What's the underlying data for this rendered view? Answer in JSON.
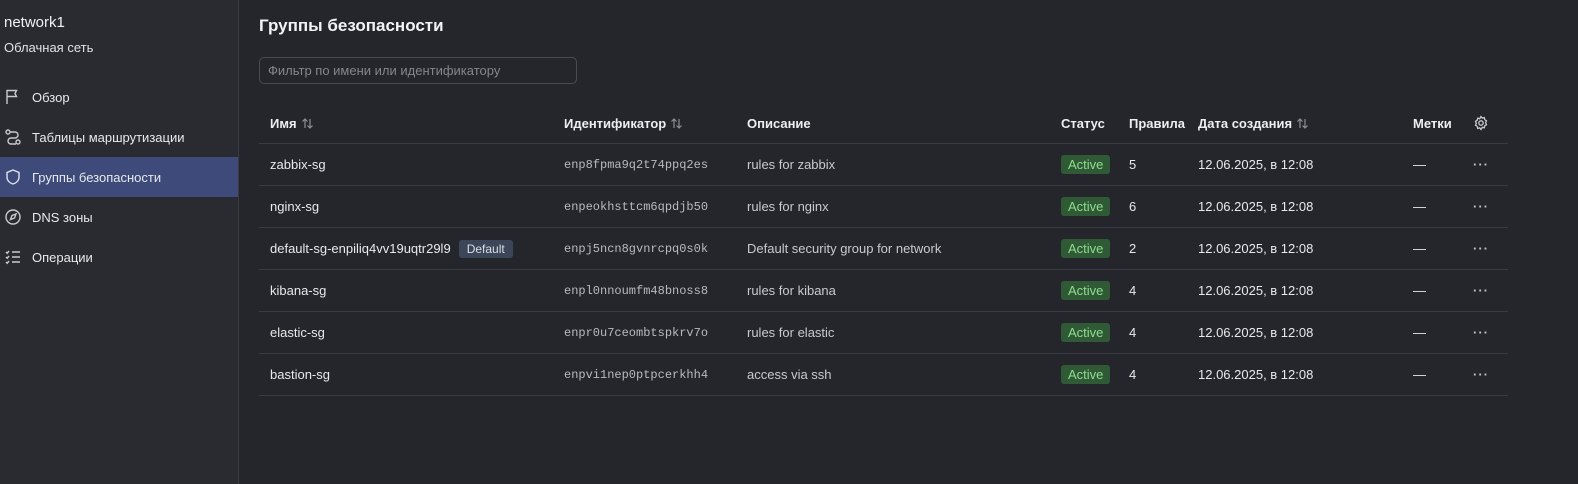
{
  "sidebar": {
    "title": "network1",
    "subtitle": "Облачная сеть",
    "items": [
      {
        "label": "Обзор",
        "icon": "flag-icon"
      },
      {
        "label": "Таблицы маршрутизации",
        "icon": "route-icon"
      },
      {
        "label": "Группы безопасности",
        "icon": "shield-icon",
        "active": true
      },
      {
        "label": "DNS зоны",
        "icon": "dns-icon"
      },
      {
        "label": "Операции",
        "icon": "list-icon"
      }
    ]
  },
  "main": {
    "title": "Группы безопасности",
    "filter_placeholder": "Фильтр по имени или идентификатору"
  },
  "table": {
    "columns": {
      "name": "Имя",
      "id": "Идентификатор",
      "description": "Описание",
      "status": "Статус",
      "rules": "Правила",
      "created": "Дата создания",
      "labels": "Метки"
    },
    "rows": [
      {
        "name": "zabbix-sg",
        "badge": "",
        "id": "enp8fpma9q2t74ppq2es",
        "description": "rules for zabbix",
        "status": "Active",
        "rules": "5",
        "created": "12.06.2025, в 12:08",
        "labels": "—",
        "actions": "···"
      },
      {
        "name": "nginx-sg",
        "badge": "",
        "id": "enpeokhsttcm6qpdjb50",
        "description": "rules for nginx",
        "status": "Active",
        "rules": "6",
        "created": "12.06.2025, в 12:08",
        "labels": "—",
        "actions": "···"
      },
      {
        "name": "default-sg-enpiliq4vv19uqtr29l9",
        "badge": "Default",
        "id": "enpj5ncn8gvnrcpq0s0k",
        "description": "Default security group for network",
        "status": "Active",
        "rules": "2",
        "created": "12.06.2025, в 12:08",
        "labels": "—",
        "actions": "···"
      },
      {
        "name": "kibana-sg",
        "badge": "",
        "id": "enpl0nnoumfm48bnoss8",
        "description": "rules for kibana",
        "status": "Active",
        "rules": "4",
        "created": "12.06.2025, в 12:08",
        "labels": "—",
        "actions": "···"
      },
      {
        "name": "elastic-sg",
        "badge": "",
        "id": "enpr0u7ceombtspkrv7o",
        "description": "rules for elastic",
        "status": "Active",
        "rules": "4",
        "created": "12.06.2025, в 12:08",
        "labels": "—",
        "actions": "···"
      },
      {
        "name": "bastion-sg",
        "badge": "",
        "id": "enpvi1nep0ptpcerkhh4",
        "description": "access via ssh",
        "status": "Active",
        "rules": "4",
        "created": "12.06.2025, в 12:08",
        "labels": "—",
        "actions": "···"
      }
    ]
  },
  "colors": {
    "sidebar_active": "#3d4a7a",
    "status_active_bg": "#2f5a35",
    "status_active_text": "#8fdc8e",
    "default_badge_bg": "#3b4758"
  }
}
